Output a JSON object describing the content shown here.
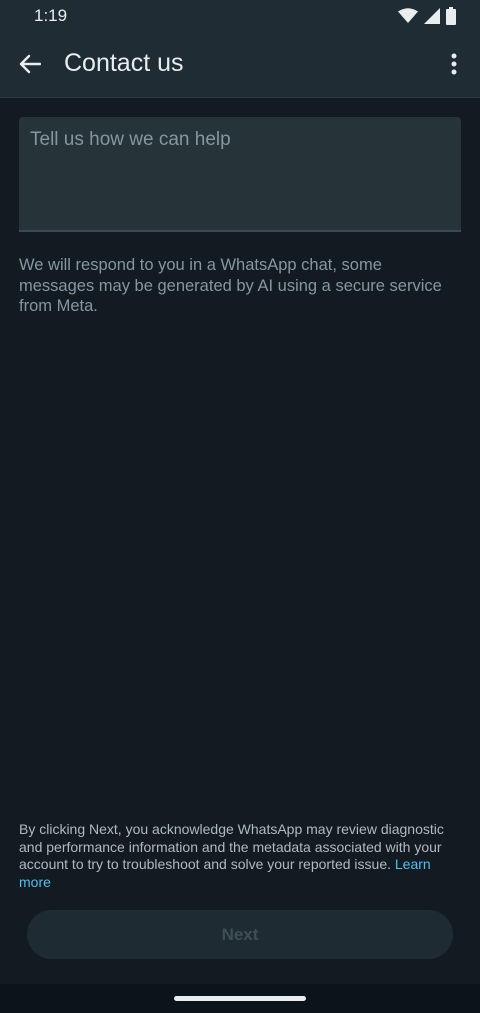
{
  "status_bar": {
    "time": "1:19"
  },
  "app_bar": {
    "title": "Contact us"
  },
  "form": {
    "help_placeholder": "Tell us how we can help",
    "help_value": "",
    "info_text": "We will respond to you in a WhatsApp chat, some messages may be generated by AI using a secure service from Meta."
  },
  "disclaimer": {
    "text": "By clicking Next, you acknowledge WhatsApp may review diagnostic and performance information and the metadata associated with your account to try to troubleshoot and solve your reported issue.",
    "link_label": "Learn more"
  },
  "actions": {
    "next_label": "Next"
  },
  "colors": {
    "background": "#121b22",
    "app_bar": "#1f2c34",
    "link": "#53bdeb",
    "muted_text": "#8696a0"
  },
  "icons": [
    "wifi-icon",
    "signal-icon",
    "battery-icon",
    "back-arrow-icon",
    "more-vert-icon"
  ]
}
